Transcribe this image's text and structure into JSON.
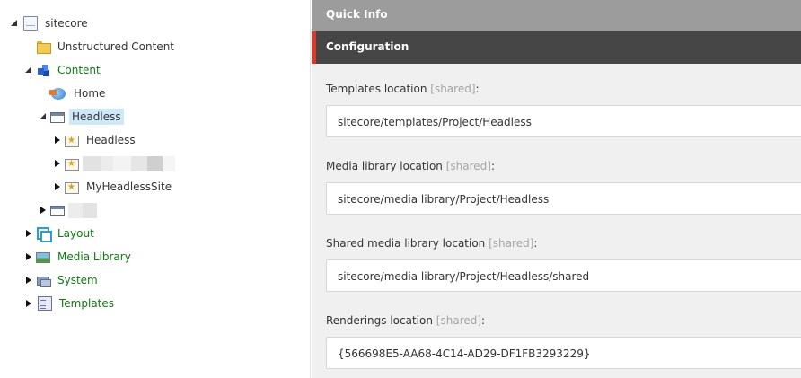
{
  "tree": {
    "root_label": "sitecore",
    "items": {
      "unstructured": "Unstructured Content",
      "content": "Content",
      "home": "Home",
      "headless_folder": "Headless",
      "headless_site": "Headless",
      "my_headless_site": "MyHeadlessSite",
      "layout": "Layout",
      "media_library": "Media Library",
      "system": "System",
      "templates": "Templates"
    }
  },
  "panel": {
    "quick_info": "Quick Info",
    "section": "Configuration",
    "fields": [
      {
        "label": "Templates location",
        "shared": "[shared]",
        "colon": ":",
        "value": "sitecore/templates/Project/Headless"
      },
      {
        "label": "Media library location",
        "shared": "[shared]",
        "colon": ":",
        "value": "sitecore/media library/Project/Headless"
      },
      {
        "label": "Shared media library location",
        "shared": "[shared]",
        "colon": ":",
        "value": "sitecore/media library/Project/Headless/shared"
      },
      {
        "label": "Renderings location",
        "shared": "[shared]",
        "colon": ":",
        "value": "{566698E5-AA68-4C14-AD29-DF1FB3293229}"
      }
    ]
  }
}
